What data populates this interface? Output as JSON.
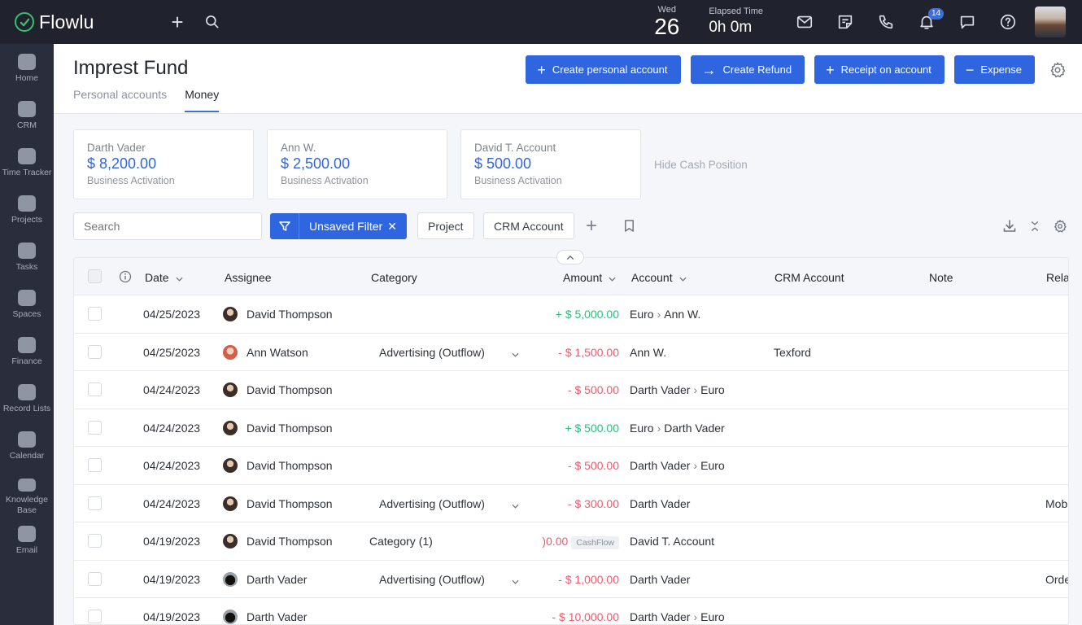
{
  "app": {
    "name": "Flowlu"
  },
  "topbar": {
    "date_dow": "Wed",
    "date_day": "26",
    "elapsed_label": "Elapsed Time",
    "elapsed_value": "0h 0m",
    "notifications_count": "14"
  },
  "sidebar": {
    "items": [
      {
        "label": "Home",
        "icon": "home-icon"
      },
      {
        "label": "CRM",
        "icon": "crm-icon"
      },
      {
        "label": "Time Tracker",
        "icon": "time-tracker-icon"
      },
      {
        "label": "Projects",
        "icon": "projects-icon"
      },
      {
        "label": "Tasks",
        "icon": "tasks-icon"
      },
      {
        "label": "Spaces",
        "icon": "spaces-icon"
      },
      {
        "label": "Finance",
        "icon": "finance-icon"
      },
      {
        "label": "Record Lists",
        "icon": "record-lists-icon"
      },
      {
        "label": "Calendar",
        "icon": "calendar-icon"
      },
      {
        "label": "Knowledge Base",
        "icon": "knowledge-base-icon"
      },
      {
        "label": "Email",
        "icon": "email-icon"
      }
    ]
  },
  "page": {
    "title": "Imprest Fund",
    "tabs": [
      "Personal accounts",
      "Money"
    ],
    "active_tab": "Money"
  },
  "actions": {
    "create_personal": "Create personal account",
    "create_refund": "Create Refund",
    "receipt": "Receipt on account",
    "expense": "Expense"
  },
  "cards": [
    {
      "name": "Darth Vader",
      "value": "$ 8,200.00",
      "sub": "Business Activation"
    },
    {
      "name": "Ann W.",
      "value": "$ 2,500.00",
      "sub": "Business Activation"
    },
    {
      "name": "David T. Account",
      "value": "$ 500.00",
      "sub": "Business Activation"
    }
  ],
  "hide_cash": "Hide Cash Position",
  "filters": {
    "search_placeholder": "Search",
    "unsaved": "Unsaved Filter",
    "chips": [
      "Project",
      "CRM Account"
    ]
  },
  "table": {
    "columns": {
      "date": "Date",
      "assignee": "Assignee",
      "category": "Category",
      "amount": "Amount",
      "account": "Account",
      "crm": "CRM Account",
      "note": "Note",
      "related": "Rela"
    },
    "rows": [
      {
        "date": "04/25/2023",
        "assignee": "David Thompson",
        "av": "dt",
        "category": "",
        "amount": "+ $ 5,000.00",
        "sign": "pos",
        "acc_from": "Euro",
        "acc_to": "Ann W.",
        "crm": "",
        "related": ""
      },
      {
        "date": "04/25/2023",
        "assignee": "Ann Watson",
        "av": "aw",
        "category": "Advertising (Outflow)",
        "amount": "- $ 1,500.00",
        "sign": "neg",
        "acc_from": "Ann W.",
        "acc_to": "",
        "crm": "Texford",
        "related": ""
      },
      {
        "date": "04/24/2023",
        "assignee": "David Thompson",
        "av": "dt",
        "category": "",
        "amount": "- $ 500.00",
        "sign": "neg",
        "acc_from": "Darth Vader",
        "acc_to": "Euro",
        "crm": "",
        "related": ""
      },
      {
        "date": "04/24/2023",
        "assignee": "David Thompson",
        "av": "dt",
        "category": "",
        "amount": "+ $ 500.00",
        "sign": "pos",
        "acc_from": "Euro",
        "acc_to": "Darth Vader",
        "crm": "",
        "related": ""
      },
      {
        "date": "04/24/2023",
        "assignee": "David Thompson",
        "av": "dt",
        "category": "",
        "amount": "- $ 500.00",
        "sign": "neg",
        "acc_from": "Darth Vader",
        "acc_to": "Euro",
        "crm": "",
        "related": ""
      },
      {
        "date": "04/24/2023",
        "assignee": "David Thompson",
        "av": "dt",
        "category": "Advertising (Outflow)",
        "amount": "- $ 300.00",
        "sign": "neg",
        "acc_from": "Darth Vader",
        "acc_to": "",
        "crm": "",
        "related": "Mobi"
      },
      {
        "date": "04/19/2023",
        "assignee": "David Thompson",
        "av": "dt",
        "category": "Category (1)",
        "amount": ")0.00",
        "sign": "neg",
        "badge": "CashFlow",
        "acc_from": "David T. Account",
        "acc_to": "",
        "crm": "",
        "related": ""
      },
      {
        "date": "04/19/2023",
        "assignee": "Darth Vader",
        "av": "dv",
        "category": "Advertising (Outflow)",
        "amount": "- $ 1,000.00",
        "sign": "neg",
        "acc_from": "Darth Vader",
        "acc_to": "",
        "crm": "",
        "related": "Orde"
      },
      {
        "date": "04/19/2023",
        "assignee": "Darth Vader",
        "av": "dv",
        "category": "",
        "amount": "- $ 10,000.00",
        "sign": "neg",
        "acc_from": "Darth Vader",
        "acc_to": "Euro",
        "crm": "",
        "related": ""
      }
    ]
  }
}
